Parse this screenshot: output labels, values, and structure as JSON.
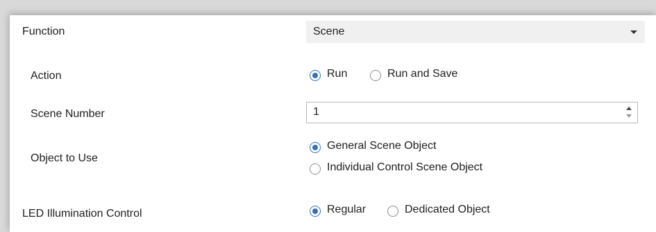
{
  "rows": {
    "function": {
      "label": "Function",
      "dropdown": {
        "value": "Scene",
        "icon": "chevron-down-icon"
      }
    },
    "action": {
      "label": "Action",
      "options": [
        {
          "label": "Run",
          "selected": true
        },
        {
          "label": "Run and Save",
          "selected": false
        }
      ]
    },
    "scene_number": {
      "label": "Scene Number",
      "value": "1"
    },
    "object_to_use": {
      "label": "Object to Use",
      "options": [
        {
          "label": "General Scene Object",
          "selected": true
        },
        {
          "label": "Individual Control Scene Object",
          "selected": false
        }
      ]
    },
    "led_illumination": {
      "label": "LED Illumination Control",
      "options": [
        {
          "label": "Regular",
          "selected": true
        },
        {
          "label": "Dedicated Object",
          "selected": false
        }
      ]
    }
  },
  "colors": {
    "accent": "#3a6fb0",
    "dropdown_bg": "#f0f0f0"
  }
}
